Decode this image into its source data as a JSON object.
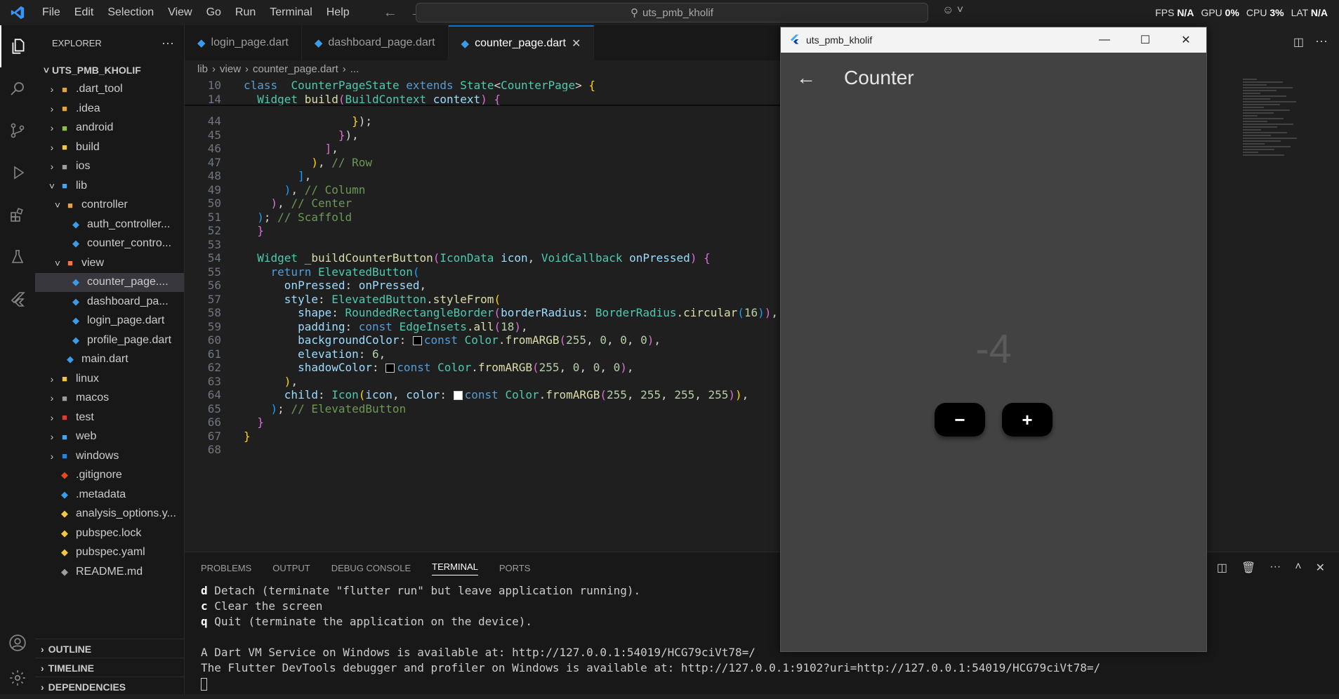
{
  "titlebar": {
    "menu": [
      "File",
      "Edit",
      "Selection",
      "View",
      "Go",
      "Run",
      "Terminal",
      "Help"
    ],
    "search": "uts_pmb_kholif",
    "perf": [
      {
        "label": "FPS",
        "value": "N/A"
      },
      {
        "label": "GPU",
        "value": "0%"
      },
      {
        "label": "CPU",
        "value": "3%"
      },
      {
        "label": "LAT",
        "value": "N/A"
      }
    ]
  },
  "sidebar": {
    "title": "EXPLORER",
    "root": "UTS_PMB_KHOLIF",
    "items": [
      {
        "label": ".dart_tool",
        "depth": 1,
        "folder": true,
        "open": false,
        "icon": "#e8a33d"
      },
      {
        "label": ".idea",
        "depth": 1,
        "folder": true,
        "open": false,
        "icon": "#e8a33d"
      },
      {
        "label": "android",
        "depth": 1,
        "folder": true,
        "open": false,
        "icon": "#8bc34a"
      },
      {
        "label": "build",
        "depth": 1,
        "folder": true,
        "open": false,
        "icon": "#f4c542"
      },
      {
        "label": "ios",
        "depth": 1,
        "folder": true,
        "open": false,
        "icon": "#9e9e9e"
      },
      {
        "label": "lib",
        "depth": 1,
        "folder": true,
        "open": true,
        "icon": "#42a5f5"
      },
      {
        "label": "controller",
        "depth": 2,
        "folder": true,
        "open": true,
        "icon": "#e8a33d"
      },
      {
        "label": "auth_controller...",
        "depth": 3,
        "folder": false,
        "icon": "#3b9be8"
      },
      {
        "label": "counter_contro...",
        "depth": 3,
        "folder": false,
        "icon": "#3b9be8"
      },
      {
        "label": "view",
        "depth": 2,
        "folder": true,
        "open": true,
        "icon": "#ff7043"
      },
      {
        "label": "counter_page....",
        "depth": 3,
        "folder": false,
        "icon": "#3b9be8",
        "selected": true
      },
      {
        "label": "dashboard_pa...",
        "depth": 3,
        "folder": false,
        "icon": "#3b9be8"
      },
      {
        "label": "login_page.dart",
        "depth": 3,
        "folder": false,
        "icon": "#3b9be8"
      },
      {
        "label": "profile_page.dart",
        "depth": 3,
        "folder": false,
        "icon": "#3b9be8"
      },
      {
        "label": "main.dart",
        "depth": 2,
        "folder": false,
        "icon": "#3b9be8"
      },
      {
        "label": "linux",
        "depth": 1,
        "folder": true,
        "open": false,
        "icon": "#f4c542"
      },
      {
        "label": "macos",
        "depth": 1,
        "folder": true,
        "open": false,
        "icon": "#9e9e9e"
      },
      {
        "label": "test",
        "depth": 1,
        "folder": true,
        "open": false,
        "icon": "#e53935"
      },
      {
        "label": "web",
        "depth": 1,
        "folder": true,
        "open": false,
        "icon": "#42a5f5"
      },
      {
        "label": "windows",
        "depth": 1,
        "folder": true,
        "open": false,
        "icon": "#1e88e5"
      },
      {
        "label": ".gitignore",
        "depth": 1,
        "folder": false,
        "icon": "#e64a19"
      },
      {
        "label": ".metadata",
        "depth": 1,
        "folder": false,
        "icon": "#3b9be8"
      },
      {
        "label": "analysis_options.y...",
        "depth": 1,
        "folder": false,
        "icon": "#f4c542"
      },
      {
        "label": "pubspec.lock",
        "depth": 1,
        "folder": false,
        "icon": "#f4c542"
      },
      {
        "label": "pubspec.yaml",
        "depth": 1,
        "folder": false,
        "icon": "#f4c542"
      },
      {
        "label": "README.md",
        "depth": 1,
        "folder": false,
        "icon": "#9e9e9e"
      }
    ],
    "sections": [
      "OUTLINE",
      "TIMELINE",
      "DEPENDENCIES"
    ]
  },
  "tabs": [
    {
      "label": "login_page.dart",
      "active": false
    },
    {
      "label": "dashboard_page.dart",
      "active": false
    },
    {
      "label": "counter_page.dart",
      "active": true
    }
  ],
  "breadcrumb": [
    "lib",
    "view",
    "counter_page.dart",
    "..."
  ],
  "code": {
    "sticky": [
      {
        "n": "10",
        "html": "<span class='kw'>class</span> <span class='ty'>_CounterPageState</span> <span class='kw'>extends</span> <span class='ty'>State</span>&lt;<span class='ty'>CounterPage</span>&gt; <span class='b1'>{</span>"
      },
      {
        "n": "14",
        "html": "  <span class='ty'>Widget</span> <span class='fn'>build</span><span class='b2'>(</span><span class='ty'>BuildContext</span> <span class='pa'>context</span><span class='b2'>)</span> <span class='b2'>{</span>"
      }
    ],
    "lines": [
      {
        "n": "44",
        "html": "                <span class='b1'>}</span>);"
      },
      {
        "n": "45",
        "html": "              <span class='b2'>}</span>),"
      },
      {
        "n": "46",
        "html": "            <span class='b2'>]</span>,"
      },
      {
        "n": "47",
        "html": "          <span class='b1'>)</span>, <span class='cm'>// Row</span>"
      },
      {
        "n": "48",
        "html": "        <span class='b3'>]</span>,"
      },
      {
        "n": "49",
        "html": "      <span class='b3'>)</span>, <span class='cm'>// Column</span>"
      },
      {
        "n": "50",
        "html": "    <span class='b2'>)</span>, <span class='cm'>// Center</span>"
      },
      {
        "n": "51",
        "html": "  <span class='b3'>)</span>; <span class='cm'>// Scaffold</span>"
      },
      {
        "n": "52",
        "html": "  <span class='b2'>}</span>"
      },
      {
        "n": "53",
        "html": ""
      },
      {
        "n": "54",
        "html": "  <span class='ty'>Widget</span> <span class='fn'>_buildCounterButton</span><span class='b2'>(</span><span class='ty'>IconData</span> <span class='pa'>icon</span>, <span class='ty'>VoidCallback</span> <span class='pa'>onPressed</span><span class='b2'>)</span> <span class='b2'>{</span>"
      },
      {
        "n": "55",
        "html": "    <span class='kw'>return</span> <span class='ty'>ElevatedButton</span><span class='b3'>(</span>"
      },
      {
        "n": "56",
        "html": "      <span class='pa'>onPressed</span>: <span class='pa'>onPressed</span>,"
      },
      {
        "n": "57",
        "html": "      <span class='pa'>style</span>: <span class='ty'>ElevatedButton</span>.<span class='fn'>styleFrom</span><span class='b1'>(</span>"
      },
      {
        "n": "58",
        "html": "        <span class='pa'>shape</span>: <span class='ty'>RoundedRectangleBorder</span><span class='b2'>(</span><span class='pa'>borderRadius</span>: <span class='ty'>BorderRadius</span>.<span class='fn'>circular</span><span class='b3'>(</span><span class='nu'>16</span><span class='b3'>)</span><span class='b2'>)</span>,"
      },
      {
        "n": "59",
        "html": "        <span class='pa'>padding</span>: <span class='kw'>const</span> <span class='ty'>EdgeInsets</span>.<span class='fn'>all</span><span class='b2'>(</span><span class='nu'>18</span><span class='b2'>)</span>,"
      },
      {
        "n": "60",
        "html": "        <span class='pa'>backgroundColor</span>: <span class='sw' style='background:#000'></span><span class='kw'>const</span> <span class='ty'>Color</span>.<span class='fn'>fromARGB</span><span class='b2'>(</span><span class='nu'>255</span>, <span class='nu'>0</span>, <span class='nu'>0</span>, <span class='nu'>0</span><span class='b2'>)</span>,"
      },
      {
        "n": "61",
        "html": "        <span class='pa'>elevation</span>: <span class='nu'>6</span>,"
      },
      {
        "n": "62",
        "html": "        <span class='pa'>shadowColor</span>: <span class='sw' style='background:#000'></span><span class='kw'>const</span> <span class='ty'>Color</span>.<span class='fn'>fromARGB</span><span class='b2'>(</span><span class='nu'>255</span>, <span class='nu'>0</span>, <span class='nu'>0</span>, <span class='nu'>0</span><span class='b2'>)</span>,"
      },
      {
        "n": "63",
        "html": "      <span class='b1'>)</span>,"
      },
      {
        "n": "64",
        "html": "      <span class='pa'>child</span>: <span class='ty'>Icon</span><span class='b1'>(</span><span class='pa'>icon</span>, <span class='pa'>color</span>: <span class='sw' style='background:#fff'></span><span class='kw'>const</span> <span class='ty'>Color</span>.<span class='fn'>fromARGB</span><span class='b2'>(</span><span class='nu'>255</span>, <span class='nu'>255</span>, <span class='nu'>255</span>, <span class='nu'>255</span><span class='b2'>)</span><span class='b1'>)</span>,"
      },
      {
        "n": "65",
        "html": "    <span class='b3'>)</span>; <span class='cm'>// ElevatedButton</span>"
      },
      {
        "n": "66",
        "html": "  <span class='b2'>}</span>"
      },
      {
        "n": "67",
        "html": "<span class='b1'>}</span>"
      },
      {
        "n": "68",
        "html": ""
      }
    ]
  },
  "panel": {
    "tabs": [
      "PROBLEMS",
      "OUTPUT",
      "DEBUG CONSOLE",
      "TERMINAL",
      "PORTS"
    ],
    "active": "TERMINAL",
    "terminal": [
      {
        "k": "d",
        "t": " Detach (terminate \"flutter run\" but leave application running)."
      },
      {
        "k": "c",
        "t": " Clear the screen"
      },
      {
        "k": "q",
        "t": " Quit (terminate the application on the device)."
      },
      {
        "k": "",
        "t": ""
      },
      {
        "k": "",
        "t": "A Dart VM Service on Windows is available at: http://127.0.0.1:54019/HCG79ciVt78=/"
      },
      {
        "k": "",
        "t": "The Flutter DevTools debugger and profiler on Windows is available at: http://127.0.0.1:9102?uri=http://127.0.0.1:54019/HCG79ciVt78=/"
      }
    ]
  },
  "app": {
    "window_title": "uts_pmb_kholif",
    "appbar_title": "Counter",
    "count": "-4",
    "minus": "−",
    "plus": "+"
  }
}
